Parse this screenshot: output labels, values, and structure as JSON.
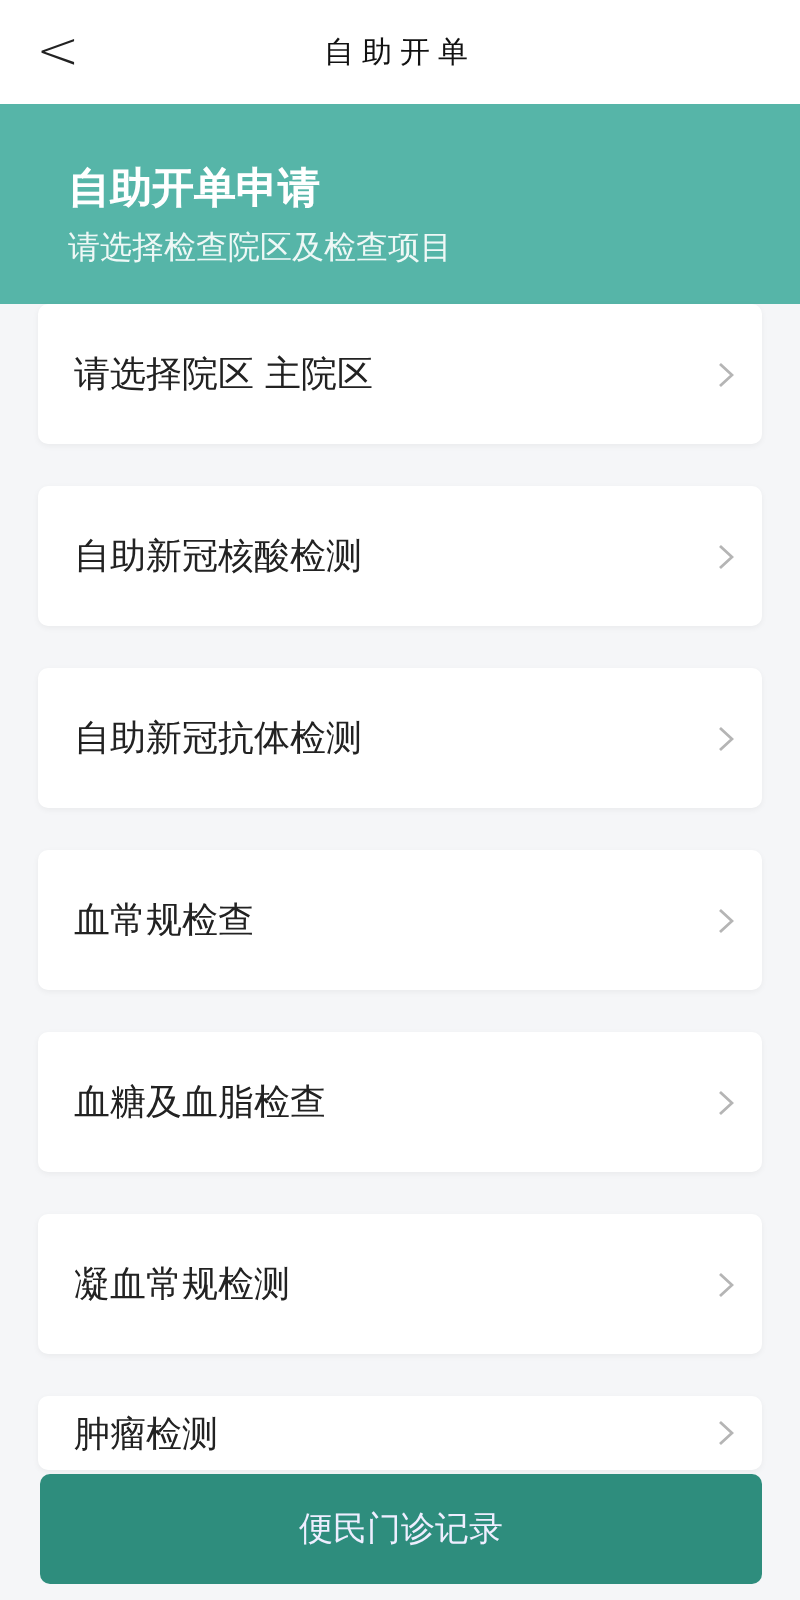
{
  "nav": {
    "back": "<",
    "title": "自助开单"
  },
  "header": {
    "title": "自助开单申请",
    "subtitle": "请选择检查院区及检查项目"
  },
  "items": [
    {
      "label": "请选择院区 主院区"
    },
    {
      "label": "自助新冠核酸检测"
    },
    {
      "label": "自助新冠抗体检测"
    },
    {
      "label": "血常规检查"
    },
    {
      "label": "血糖及血脂检查"
    },
    {
      "label": "凝血常规检测"
    },
    {
      "label": "肿瘤检测"
    }
  ],
  "footer_button": "便民门诊记录"
}
